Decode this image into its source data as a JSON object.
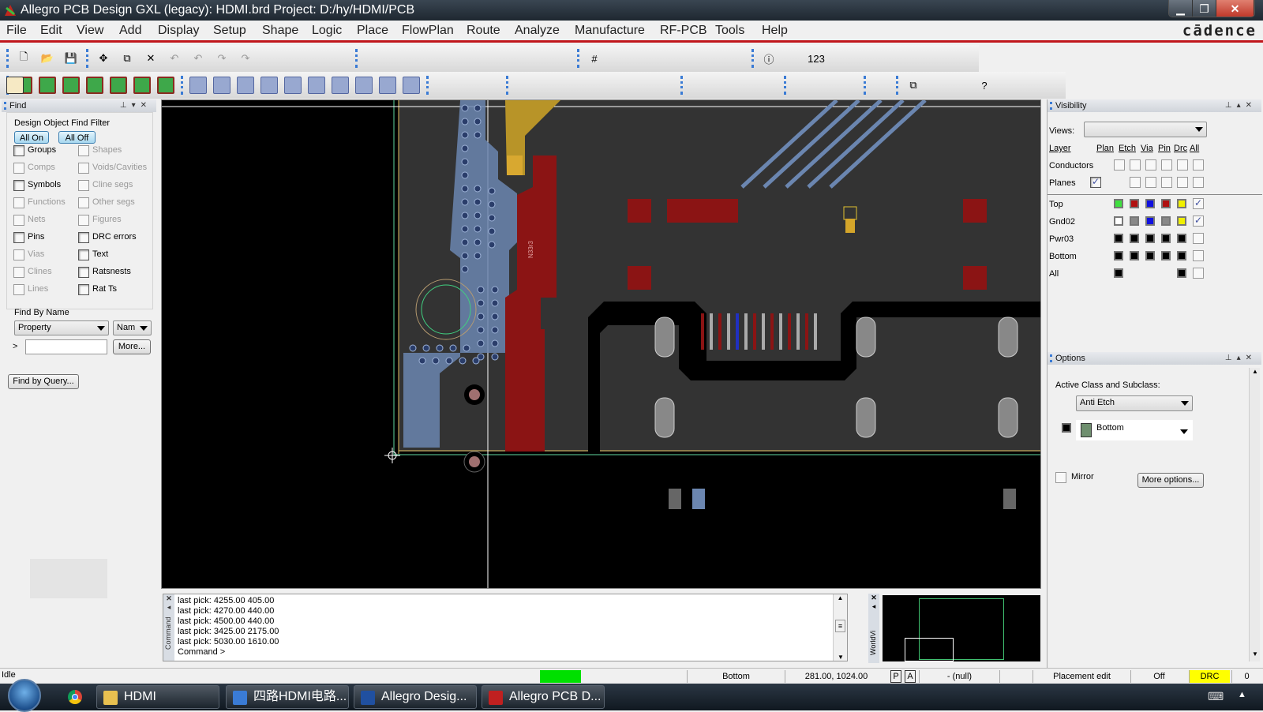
{
  "window": {
    "title": "Allegro PCB Design GXL (legacy): HDMI.brd  Project: D:/hy/HDMI/PCB",
    "minimize_icon": "minimize-icon",
    "maximize_icon": "restore-icon",
    "close_icon": "close-icon"
  },
  "menu": {
    "items": [
      "File",
      "Edit",
      "View",
      "Add",
      "Display",
      "Setup",
      "Shape",
      "Logic",
      "Place",
      "FlowPlan",
      "Route",
      "Analyze",
      "Manufacture",
      "RF-PCB",
      "Tools",
      "Help"
    ],
    "brand": "cādence"
  },
  "toolbar1": {
    "icons": [
      "new-icon",
      "open-icon",
      "save-icon",
      "move-icon",
      "copy-icon",
      "delete-icon",
      "undo-icon",
      "undo-list-icon",
      "redo-icon",
      "redo-list-icon",
      "shape-icon",
      "pin-icon",
      "unrats-icon",
      "rats-icon",
      "zoom-fit-icon",
      "zoom-in-region-icon",
      "zoom-in-icon",
      "zoom-out-icon",
      "zoom-previous-icon",
      "zoom-world-icon",
      "refresh-icon",
      "3d-view-icon",
      "flip-icon",
      "grid-icon",
      "color-icon",
      "assign-color-icon",
      "layer-icon",
      "cm-icon",
      "dfa-icon",
      "world-icon",
      "info-icon",
      "props-icon",
      "measure-icon",
      "highlight-icon",
      "dehighlight-icon",
      "shadow-icon",
      "columns-icon",
      "hourglass-icon",
      "drc-icon"
    ]
  },
  "toolbar2": {
    "icons": [
      "route-mode-1-icon",
      "route-mode-2-icon",
      "route-mode-3-icon",
      "route-mode-4-icon",
      "route-mode-5-icon",
      "route-mode-6-icon",
      "route-mode-7-icon",
      "shape-add-poly-icon",
      "shape-add-rect-icon",
      "shape-add-circle-icon",
      "shape-select-icon",
      "shape-manual-void-icon",
      "shape-void-circle-icon",
      "shape-void-rect-icon",
      "shape-void-element-icon",
      "shape-edit-boundary-icon",
      "shape-delete-islands-icon",
      "place-manual-icon",
      "dimension-icon",
      "dimension-linear-icon",
      "add-connect-icon",
      "slide-icon",
      "delay-tune-icon",
      "spread-icon",
      "custom-smooth-icon",
      "bus-icon",
      "fanout-icon",
      "phase-tune-icon",
      "add-line-icon",
      "add-rect-icon",
      "add-text-icon",
      "edit-text-icon",
      "place-icon",
      "swap-icon",
      "assign-icon",
      "spline-icon",
      "copy-window-icon",
      "zoom-bowtie-icon",
      "bowtie-icon",
      "help-icon"
    ],
    "selected": "phase-tune-icon"
  },
  "find_panel": {
    "title": "Find",
    "section_title": "Design Object Find Filter",
    "all_on": "All On",
    "all_off": "All Off",
    "left_items": [
      {
        "label": "Groups",
        "enabled": true,
        "checked": false
      },
      {
        "label": "Comps",
        "enabled": false,
        "checked": false
      },
      {
        "label": "Symbols",
        "enabled": true,
        "checked": false
      },
      {
        "label": "Functions",
        "enabled": false,
        "checked": false
      },
      {
        "label": "Nets",
        "enabled": false,
        "checked": false
      },
      {
        "label": "Pins",
        "enabled": true,
        "checked": false
      },
      {
        "label": "Vias",
        "enabled": false,
        "checked": false
      },
      {
        "label": "Clines",
        "enabled": false,
        "checked": false
      },
      {
        "label": "Lines",
        "enabled": false,
        "checked": false
      }
    ],
    "right_items": [
      {
        "label": "Shapes",
        "enabled": false,
        "checked": false
      },
      {
        "label": "Voids/Cavities",
        "enabled": false,
        "checked": false
      },
      {
        "label": "Cline segs",
        "enabled": false,
        "checked": false
      },
      {
        "label": "Other segs",
        "enabled": false,
        "checked": false
      },
      {
        "label": "Figures",
        "enabled": false,
        "checked": false
      },
      {
        "label": "DRC errors",
        "enabled": true,
        "checked": false
      },
      {
        "label": "Text",
        "enabled": true,
        "checked": false
      },
      {
        "label": "Ratsnests",
        "enabled": true,
        "checked": false
      },
      {
        "label": "Rat Ts",
        "enabled": true,
        "checked": false
      }
    ],
    "find_by_name_title": "Find By Name",
    "property_select": "Property",
    "name_select": "Nam",
    "prompt": ">",
    "name_input_value": "",
    "more_button": "More...",
    "find_by_query_button": "Find by Query..."
  },
  "visibility_panel": {
    "title": "Visibility",
    "views_label": "Views:",
    "views_value": "",
    "columns": [
      "Layer",
      "Plan",
      "Etch",
      "Via",
      "Pin",
      "Drc",
      "All"
    ],
    "global_rows": [
      {
        "label": "Conductors",
        "checked": false
      },
      {
        "label": "Planes",
        "checked": true
      }
    ],
    "layers": [
      {
        "name": "Top",
        "colors": [
          "#3ee03e",
          "#b01010",
          "#1010e0",
          "#b01010",
          "#f0f000"
        ],
        "all": true
      },
      {
        "name": "Gnd02",
        "colors": [
          "#ffffff",
          "#888888",
          "#1010e0",
          "#888888",
          "#f0f000"
        ],
        "all": true
      },
      {
        "name": "Pwr03",
        "colors": [
          "#000000",
          "#000000",
          "#000000",
          "#000000",
          "#000000"
        ],
        "all": false
      },
      {
        "name": "Bottom",
        "colors": [
          "#000000",
          "#000000",
          "#000000",
          "#000000",
          "#000000"
        ],
        "all": false
      },
      {
        "name": "All",
        "colors": [
          "#000000",
          null,
          null,
          null,
          "#000000"
        ],
        "all": false
      }
    ]
  },
  "options_panel": {
    "title": "Options",
    "active_class_label": "Active Class and Subclass:",
    "class_value": "Anti Etch",
    "subclass_value": "Bottom",
    "subclass_color": "#6f8f6f",
    "mirror_label": "Mirror",
    "mirror_checked": false,
    "more_options_button": "More options..."
  },
  "canvas": {
    "component_label": "N33r3",
    "colors": {
      "background": "#000000",
      "board": "#333333",
      "etch_top": "#8b1414",
      "via_blue": "#6b86b0",
      "highlight": "#d4a52a",
      "outline": "#e0d060",
      "green": "#40d080"
    }
  },
  "command_window": {
    "side_label": "Command",
    "lines": [
      "last pick:  4255.00 405.00",
      "last pick:  4270.00 440.00",
      "last pick:  4500.00 440.00",
      "last pick:  3425.00 2175.00",
      "last pick:  5030.00 1610.00",
      "Command >"
    ]
  },
  "worldview": {
    "side_label": "WorldVi"
  },
  "statusbar": {
    "state": "Idle",
    "active_layer": "Bottom",
    "coords": "281.00, 1024.00",
    "p_button": "P",
    "a_button": "A",
    "null_text": "- (null)",
    "mode": "Placement edit",
    "off": "Off",
    "drc": "DRC",
    "drc_count": "0",
    "busy_color": "#00e000"
  },
  "taskbar": {
    "tasks": [
      {
        "label": "HDMI",
        "icon": "folder-icon"
      },
      {
        "label": "四路HDMI电路...",
        "icon": "powerpoint-icon"
      },
      {
        "label": "Allegro Desig...",
        "icon": "allegro-design-icon"
      },
      {
        "label": "Allegro PCB D...",
        "icon": "allegro-pcb-icon"
      }
    ]
  }
}
